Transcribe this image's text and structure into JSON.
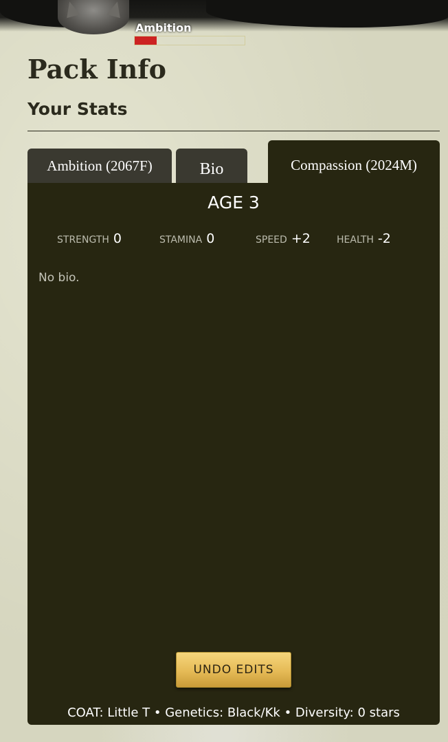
{
  "header": {
    "wolf_name": "Ambition",
    "health_fill": 0.2
  },
  "page": {
    "title": "Pack Info",
    "section_title": "Your Stats"
  },
  "tabs": [
    {
      "label": "Ambition (2067F)",
      "active": false
    },
    {
      "label": "Bio",
      "active": false
    },
    {
      "label": "Compassion (2024M)",
      "active": true
    }
  ],
  "panel": {
    "age": "AGE 3",
    "stats": [
      {
        "label": "STRENGTH",
        "value": "0"
      },
      {
        "label": "STAMINA",
        "value": "0"
      },
      {
        "label": "SPEED",
        "value": "+2"
      },
      {
        "label": "HEALTH",
        "value": "-2"
      }
    ],
    "bio": "No bio.",
    "undo_label": "UNDO EDITS",
    "footer": "COAT: Little T • Genetics: Black/Kk • Diversity: 0 stars"
  },
  "colors": {
    "panel_bg": "#272611",
    "tab_bg": "#3a3930",
    "button_gold": "#e5ba56",
    "page_bg": "#d6d6bf",
    "health_red": "#cc2222"
  },
  "icons": {
    "avatar": "wolf-avatar"
  }
}
